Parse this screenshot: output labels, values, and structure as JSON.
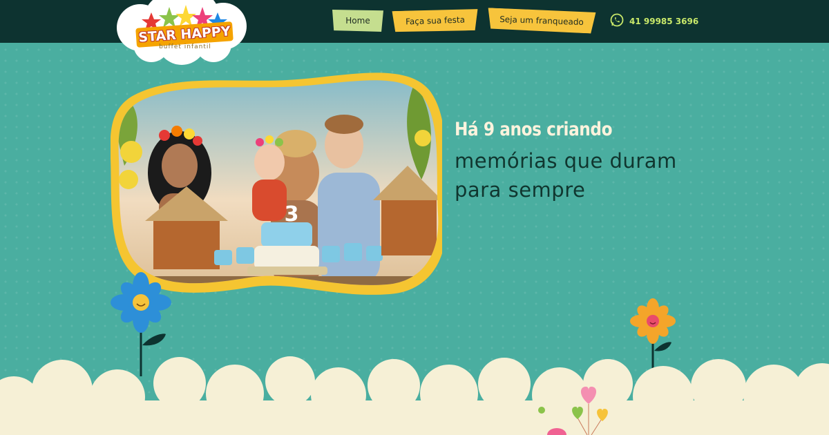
{
  "header": {
    "logo": {
      "brand_name": "STAR HAPPY",
      "tagline": "buffet infantil"
    },
    "nav": [
      {
        "label": "Home",
        "active": true
      },
      {
        "label": "Faça sua festa",
        "active": false
      },
      {
        "label": "Seja um franqueado",
        "active": false
      }
    ],
    "contact": {
      "icon": "whatsapp-icon",
      "phone": "41 99985 3696"
    }
  },
  "hero": {
    "headline": "Há 9 anos criando",
    "subline_line1": "memórias que duram",
    "subline_line2": "para sempre",
    "photo": "festa-de-aniversario"
  },
  "colors": {
    "background": "#4aaea0",
    "topbar": "#0d3330",
    "nav_active": "#c5de8f",
    "nav_default": "#f7c43c",
    "phone_text": "#c9e96a",
    "cloud": "#f6f0d6",
    "photo_frame": "#f5c531"
  }
}
